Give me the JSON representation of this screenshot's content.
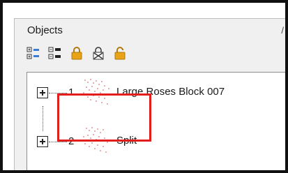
{
  "panel": {
    "title": "Objects",
    "edge_mark": "/"
  },
  "toolbar": {
    "buttons": [
      {
        "icon": "group-nodes-icon"
      },
      {
        "icon": "ungroup-nodes-icon"
      },
      {
        "icon": "lock-icon"
      },
      {
        "icon": "lock-crossed-icon"
      },
      {
        "icon": "unlock-icon"
      }
    ]
  },
  "tree": {
    "items": [
      {
        "number": "1",
        "name": "Large Roses Block 007"
      },
      {
        "number": "2",
        "name": "Split"
      }
    ]
  },
  "colors": {
    "highlight": "#e31c1c",
    "lock_gold": "#e8a317",
    "thumbnail_dots": "#d94a4a"
  }
}
